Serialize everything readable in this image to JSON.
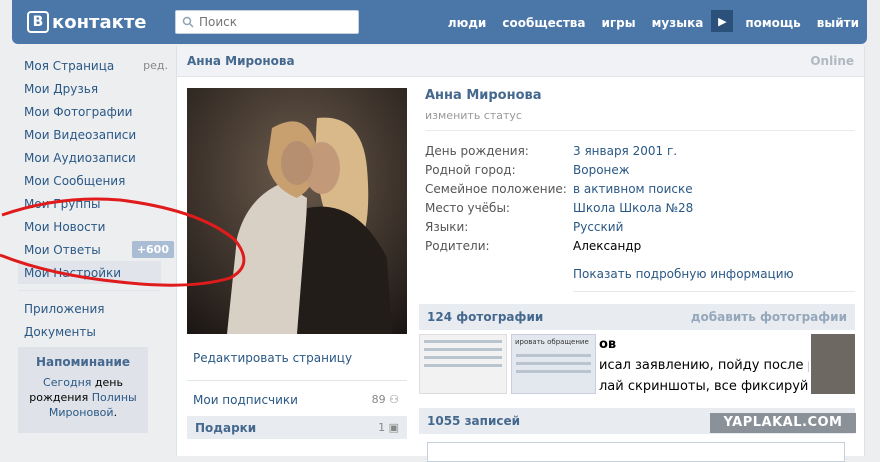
{
  "header": {
    "logo_text": "контакте",
    "logo_letter": "В",
    "search_placeholder": "Поиск",
    "nav": [
      "люди",
      "сообщества",
      "игры",
      "музыка",
      "помощь",
      "выйти"
    ]
  },
  "sidebar": {
    "items": [
      {
        "label": "Моя Страница",
        "extra": "ред."
      },
      {
        "label": "Мои Друзья"
      },
      {
        "label": "Мои Фотографии"
      },
      {
        "label": "Мои Видеозаписи"
      },
      {
        "label": "Мои Аудиозаписи"
      },
      {
        "label": "Мои Сообщения"
      },
      {
        "label": "Мои Группы"
      },
      {
        "label": "Мои Новости"
      },
      {
        "label": "Мои Ответы",
        "badge": "+600"
      },
      {
        "label": "Мои Настройки"
      }
    ],
    "secondary": [
      {
        "label": "Приложения"
      },
      {
        "label": "Документы"
      }
    ],
    "reminder": {
      "title": "Напоминание",
      "text_prefix": "Сегодня",
      "text_mid": "день рождения",
      "name": "Полины Мироновой",
      "text_suffix": "."
    }
  },
  "profile": {
    "header_name": "Анна Миронова",
    "online": "Online",
    "name": "Анна Миронова",
    "status_link": "изменить статус",
    "info": [
      {
        "label": "День рождения:",
        "value": "3 января 2001 г."
      },
      {
        "label": "Родной город:",
        "value": "Воронеж"
      },
      {
        "label": "Семейное положение:",
        "value": "в активном поиске"
      },
      {
        "label": "Место учёбы:",
        "value": "Школа Школа №28"
      },
      {
        "label": "Языки:",
        "value": "Русский"
      },
      {
        "label": "Родители:",
        "value": "Александр"
      }
    ],
    "more_link": "Показать подробную информацию",
    "edit_page": "Редактировать страницу",
    "subscribers_label": "Мои подписчики",
    "subscribers_count": "89",
    "gifts_label": "Подарки",
    "gifts_count": "1"
  },
  "photos": {
    "title": "124 фотографии",
    "add_label": "добавить фотографии",
    "thumb_text": [
      "ов",
      "исал заявлению, пойду после ра",
      "лай скриншоты, все фиксируй"
    ],
    "thumb_caption": "ировать обращение"
  },
  "posts": {
    "title": "1055 записей"
  },
  "watermark": "YAPLAKAL.COM"
}
